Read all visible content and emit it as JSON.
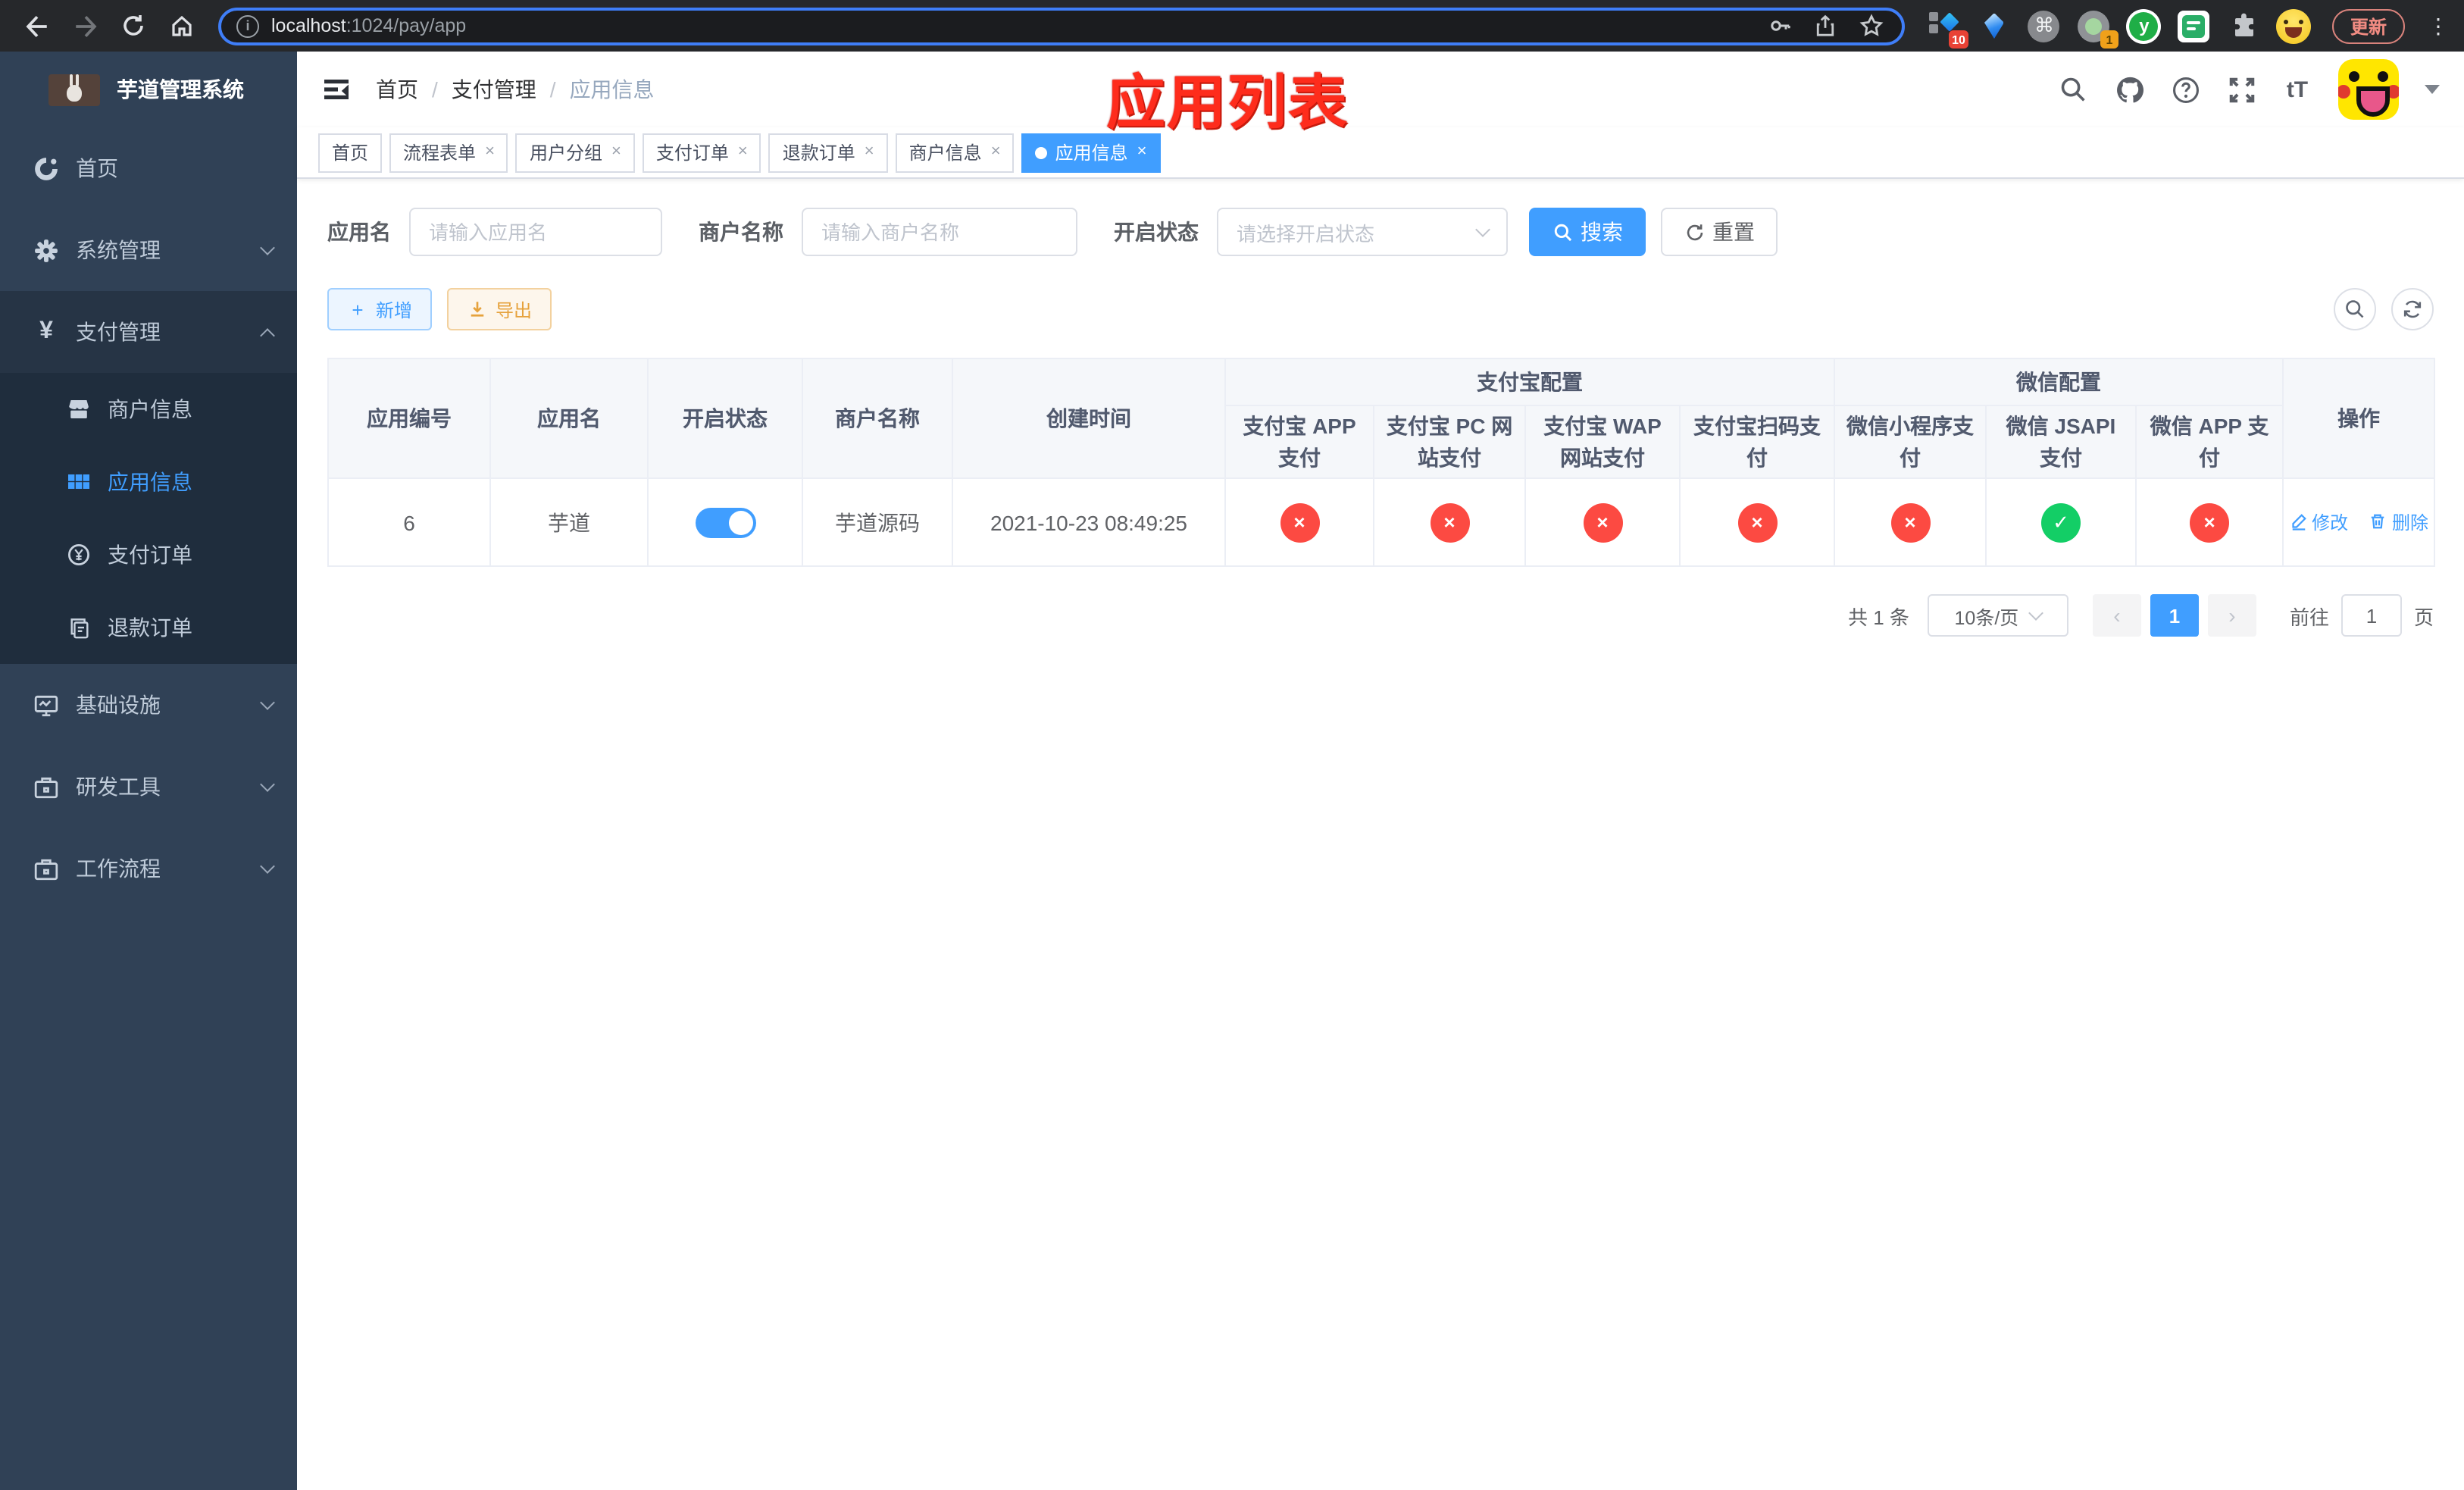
{
  "browser": {
    "url": {
      "host": "localhost",
      "rest": ":1024/pay/app"
    },
    "update_label": "更新",
    "ext_badges": {
      "first": "10",
      "fourth": "1"
    },
    "ext_y_glyph": "y",
    "command_glyph": "⌘",
    "dots_glyph": "⋮"
  },
  "sidebar": {
    "title": "芋道管理系统",
    "menu": {
      "home": "首页",
      "system": "系统管理",
      "pay": "支付管理",
      "infra": "基础设施",
      "devtool": "研发工具",
      "workflow": "工作流程"
    },
    "submenu": {
      "merchant": "商户信息",
      "app": "应用信息",
      "order": "支付订单",
      "refund": "退款订单"
    },
    "yen_glyph": "¥"
  },
  "navbar": {
    "breadcrumb": {
      "home": "首页",
      "section": "支付管理",
      "current": "应用信息",
      "sep": "/"
    },
    "font_size_glyph": "tT"
  },
  "annotation": {
    "text": "应用列表"
  },
  "tags": [
    {
      "label": "首页",
      "closable": false
    },
    {
      "label": "流程表单",
      "closable": true
    },
    {
      "label": "用户分组",
      "closable": true
    },
    {
      "label": "支付订单",
      "closable": true
    },
    {
      "label": "退款订单",
      "closable": true
    },
    {
      "label": "商户信息",
      "closable": true
    },
    {
      "label": "应用信息",
      "closable": true,
      "active": true
    }
  ],
  "close_glyph": "×",
  "search": {
    "app_name_label": "应用名",
    "app_name_placeholder": "请输入应用名",
    "merchant_label": "商户名称",
    "merchant_placeholder": "请输入商户名称",
    "status_label": "开启状态",
    "status_placeholder": "请选择开启状态",
    "search_label": "搜索",
    "reset_label": "重置"
  },
  "toolbar": {
    "add_label": "新增",
    "export_label": "导出",
    "plus_glyph": "+"
  },
  "table": {
    "headers": {
      "col_id": "应用编号",
      "col_name": "应用名",
      "col_enabled": "开启状态",
      "col_merchant": "商户名称",
      "col_created": "创建时间",
      "group_alipay": "支付宝配置",
      "group_wechat": "微信配置",
      "alipay_app": "支付宝 APP\n支付",
      "alipay_pc": "支付宝 PC 网\n站支付",
      "alipay_wap": "支付宝 WAP\n网站支付",
      "alipay_qr": "支付宝扫码支\n付",
      "wx_lite": "微信小程序支\n付",
      "wx_jsapi": "微信 JSAPI\n支付",
      "wx_app": "微信 APP 支\n付",
      "col_op": "操作"
    },
    "row": {
      "id": "6",
      "name": "芋道",
      "enabled": true,
      "merchant": "芋道源码",
      "created": "2021-10-23 08:49:25",
      "status_icons": [
        "×",
        "×",
        "×",
        "×",
        "×",
        "✓",
        "×"
      ],
      "edit_label": "修改",
      "delete_label": "删除"
    }
  },
  "pagination": {
    "total": "共 1 条",
    "page_size": "10条/页",
    "prev_glyph": "‹",
    "next_glyph": "›",
    "current_page": "1",
    "goto_label": "前往",
    "goto_value": "1",
    "page_unit": "页"
  },
  "colors": {
    "primary": "#409eff",
    "success": "#13ce66",
    "danger": "#fc4a42",
    "sidebar_bg": "#304156",
    "submenu_bg": "#1f2d3d",
    "annotation_red": "#fe2c1c"
  }
}
